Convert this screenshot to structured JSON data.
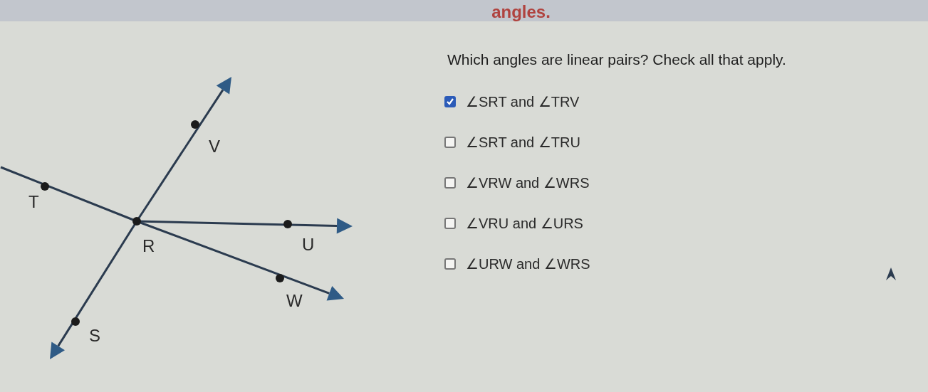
{
  "header": {
    "title": "angles."
  },
  "diagram": {
    "points": [
      {
        "label": "V"
      },
      {
        "label": "T"
      },
      {
        "label": "R"
      },
      {
        "label": "U"
      },
      {
        "label": "W"
      },
      {
        "label": "S"
      }
    ]
  },
  "question": {
    "prompt": "Which angles are linear pairs? Check all that apply.",
    "options": [
      {
        "first": "∠SRT",
        "joiner": "and",
        "second": "∠TRV",
        "checked": true
      },
      {
        "first": "∠SRT",
        "joiner": "and",
        "second": "∠TRU",
        "checked": false
      },
      {
        "first": "∠VRW",
        "joiner": "and",
        "second": "∠WRS",
        "checked": false
      },
      {
        "first": "∠VRU",
        "joiner": "and",
        "second": "∠URS",
        "checked": false
      },
      {
        "first": "∠URW",
        "joiner": "and",
        "second": "∠WRS",
        "checked": false
      }
    ]
  }
}
